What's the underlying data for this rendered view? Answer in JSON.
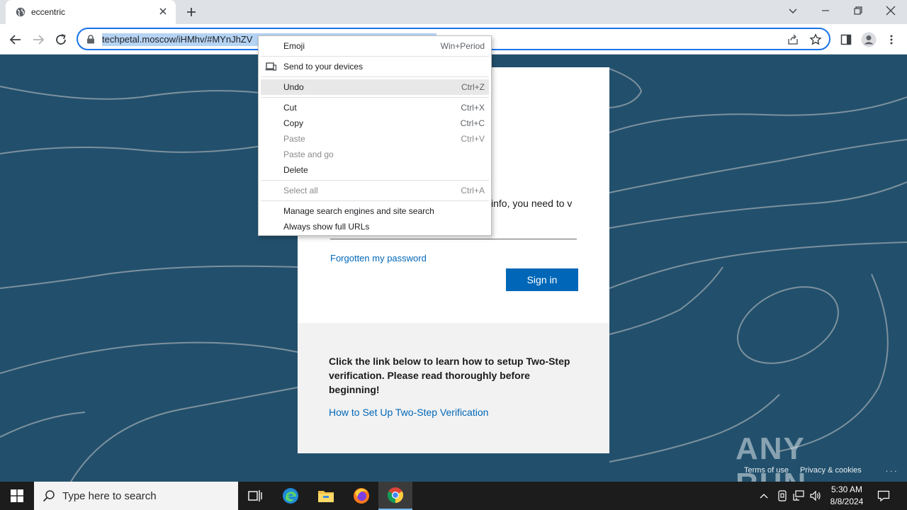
{
  "browser": {
    "tab_title": "eccentric",
    "url": "techpetal.moscow/iHMhv/#MYnJhZV"
  },
  "context_menu": {
    "items": [
      {
        "label": "Emoji",
        "shortcut": "Win+Period",
        "disabled": false
      },
      {
        "label": "Send to your devices",
        "shortcut": "",
        "disabled": false
      },
      {
        "label": "Undo",
        "shortcut": "Ctrl+Z",
        "disabled": false
      },
      {
        "label": "Cut",
        "shortcut": "Ctrl+X",
        "disabled": false
      },
      {
        "label": "Copy",
        "shortcut": "Ctrl+C",
        "disabled": false
      },
      {
        "label": "Paste",
        "shortcut": "Ctrl+V",
        "disabled": true
      },
      {
        "label": "Paste and go",
        "shortcut": "",
        "disabled": true
      },
      {
        "label": "Delete",
        "shortcut": "",
        "disabled": false
      },
      {
        "label": "Select all",
        "shortcut": "Ctrl+A",
        "disabled": true
      },
      {
        "label": "Manage search engines and site search",
        "shortcut": "",
        "disabled": false
      },
      {
        "label": "Always show full URLs",
        "shortcut": "",
        "disabled": false
      }
    ]
  },
  "page": {
    "partial_text": "info, you need to v",
    "forgot_link": "Forgotten my password",
    "signin_button": "Sign in",
    "info_text": "Click the link below to learn how to setup Two-Step verification. Please read thoroughly before beginning!",
    "howto_link": "How to Set Up Two-Step Verification"
  },
  "watermark": {
    "logo_text": "ANY RUN",
    "terms": "Terms of use",
    "privacy": "Privacy & cookies",
    "dots": ". . ."
  },
  "taskbar": {
    "search_placeholder": "Type here to search",
    "time": "5:30 AM",
    "date": "8/8/2024"
  },
  "colors": {
    "page_bg": "#22506c",
    "link": "#0067b8",
    "button": "#0067b8",
    "url_highlight": "#b5d3f3"
  }
}
